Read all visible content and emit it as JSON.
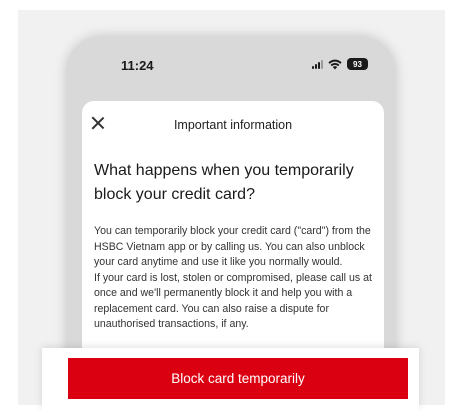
{
  "status_bar": {
    "time": "11:24",
    "battery": "93",
    "icons": [
      "signal-icon",
      "wifi-icon",
      "battery-icon"
    ]
  },
  "sheet": {
    "title": "Important information",
    "close_icon": "close-icon",
    "heading": "What happens when you temporarily block your credit card?",
    "paragraphs": [
      "You can temporarily block your credit card (\"card\") from the HSBC Vietnam app or by calling us. You can also unblock your card anytime and use it like you normally would.",
      "If your card is lost, stolen or compromised, please call us at once and we'll permanently block it and help you with a replacement card. You can also raise a dispute for unauthorised transactions, if any."
    ]
  },
  "cta": {
    "label": "Block card temporarily"
  },
  "colors": {
    "primary": "#db0011",
    "background": "#f1f1f1",
    "sheet": "#ffffff",
    "phone_frame": "#d9d9d9"
  }
}
